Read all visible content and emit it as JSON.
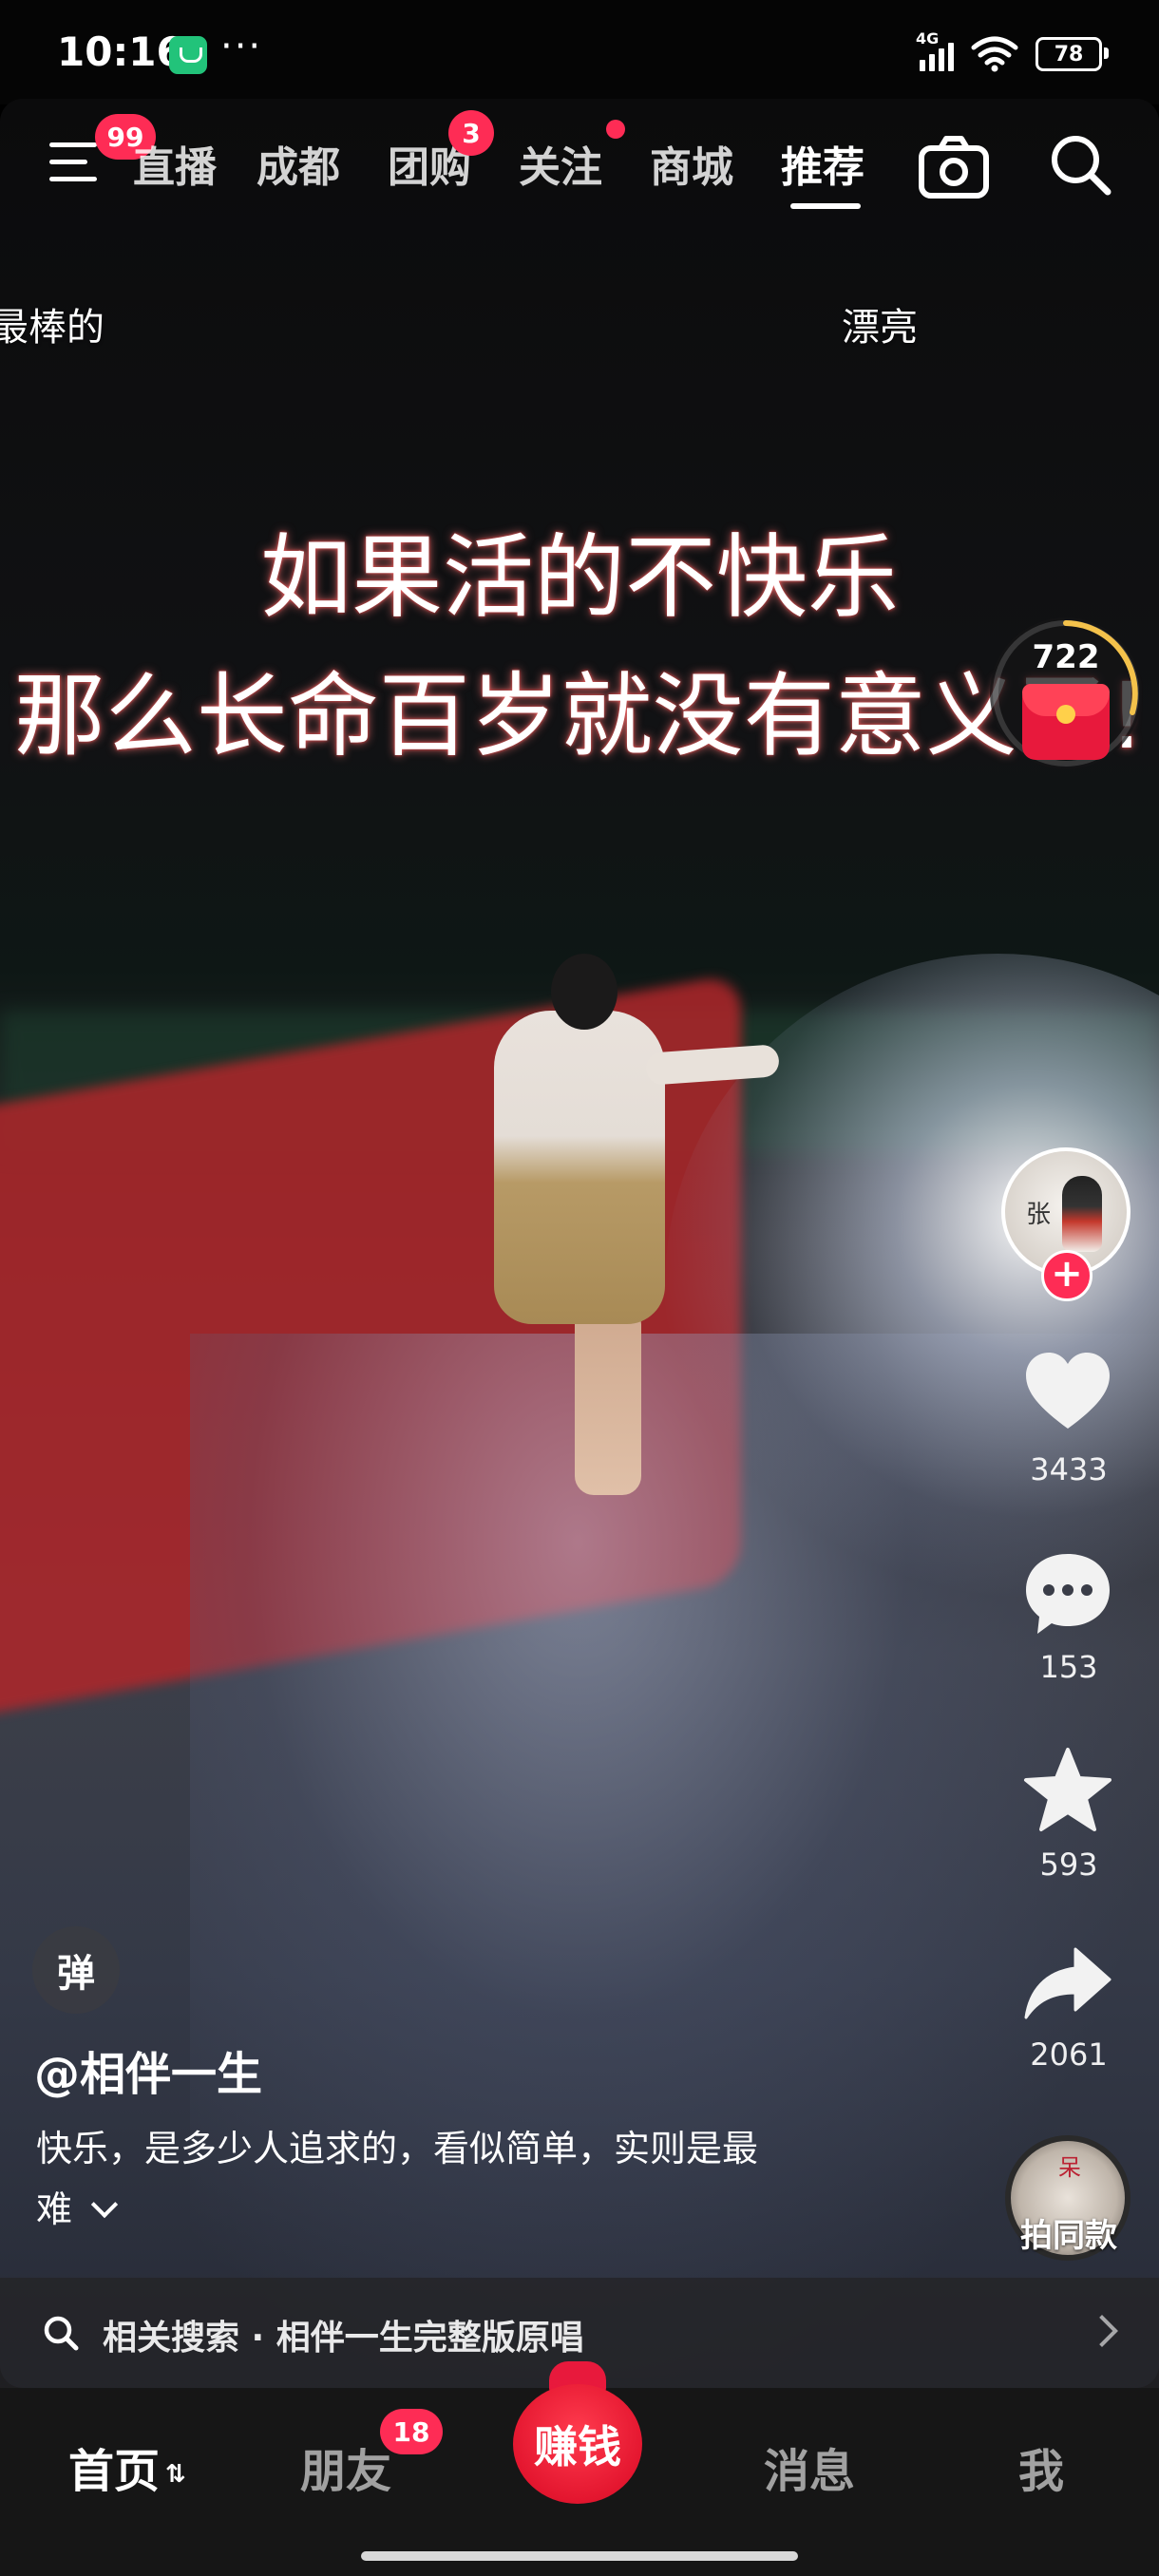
{
  "status_bar": {
    "time": "10:16",
    "more": "···",
    "network": "4G",
    "battery": "78"
  },
  "top_nav": {
    "menu_badge": "99",
    "tabs": [
      {
        "label": "直播",
        "badge": ""
      },
      {
        "label": "成都",
        "badge": ""
      },
      {
        "label": "团购",
        "badge": "3"
      },
      {
        "label": "关注",
        "badge": "dot"
      },
      {
        "label": "商城",
        "badge": ""
      },
      {
        "label": "推荐",
        "badge": "",
        "active": true
      }
    ],
    "camera_icon": "camera-icon",
    "search_icon": "search-icon"
  },
  "danmaku": [
    "最棒的",
    "漂亮"
  ],
  "video_caption": {
    "line1": "如果活的不快乐",
    "line2": "那么长命百岁就没有意义了!"
  },
  "red_packet": {
    "count": "722"
  },
  "creator": {
    "avatar_char": "张"
  },
  "actions": {
    "likes": "3433",
    "comments": "153",
    "favorites": "593",
    "shares": "2061",
    "music_label": "拍同款",
    "music_char": "呆"
  },
  "info": {
    "danmu_toggle": "弹",
    "author": "@相伴一生",
    "description_line1": "快乐，是多少人追求的，看似简单，实则是最",
    "description_line2": "难"
  },
  "related_search": {
    "text": "相关搜索 · 相伴一生完整版原唱"
  },
  "tab_bar": {
    "home": "首页",
    "friends": "朋友",
    "friends_badge": "18",
    "earn": "赚钱",
    "messages": "消息",
    "me": "我"
  },
  "colors": {
    "accent": "#fe2c55",
    "earn": "#e4162f",
    "tab_bg": "#161616"
  }
}
